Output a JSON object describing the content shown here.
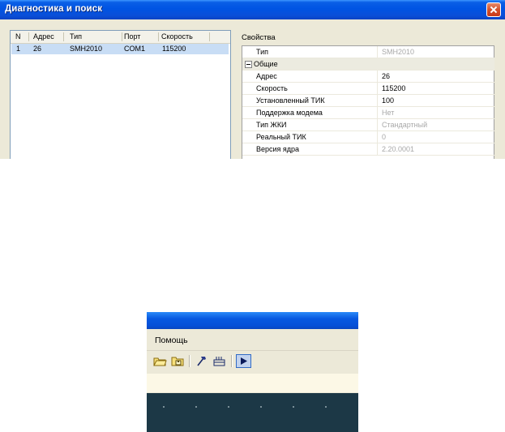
{
  "dialog": {
    "title": "Диагностика и поиск",
    "list": {
      "columns": [
        "N",
        "Адрес",
        "Тип",
        "Порт",
        "Скорость"
      ],
      "rows": [
        [
          "1",
          "26",
          "SMH2010",
          "COM1",
          "115200"
        ]
      ]
    },
    "properties": {
      "label": "Свойства",
      "rows": [
        {
          "key": "Тип",
          "value": "SMH2010",
          "readonly": true
        },
        {
          "key": "Общие",
          "category": true
        },
        {
          "key": "Адрес",
          "value": "26",
          "readonly": false
        },
        {
          "key": "Скорость",
          "value": "115200",
          "readonly": false
        },
        {
          "key": "Установленный ТИК",
          "value": "100",
          "readonly": false
        },
        {
          "key": "Поддержка модема",
          "value": "Нет",
          "readonly": true
        },
        {
          "key": "Тип ЖКИ",
          "value": "Стандартный",
          "readonly": true
        },
        {
          "key": "Реальный ТИК",
          "value": "0",
          "readonly": true
        },
        {
          "key": "Версия ядра",
          "value": "2.20.0001",
          "readonly": true
        }
      ]
    }
  },
  "toolbar_crop": {
    "menu_item": "Помощь",
    "tools": [
      {
        "icon": "folder-open-icon"
      },
      {
        "icon": "folder-save-icon"
      },
      {
        "icon": "hammer-icon"
      },
      {
        "icon": "device-icon"
      },
      {
        "icon": "play-icon",
        "active": true
      }
    ]
  },
  "colors": {
    "titlebar": "#0054e3",
    "selection": "#c8ddf5",
    "window_bg": "#ece9d8",
    "dark_panel": "#1c3846"
  }
}
